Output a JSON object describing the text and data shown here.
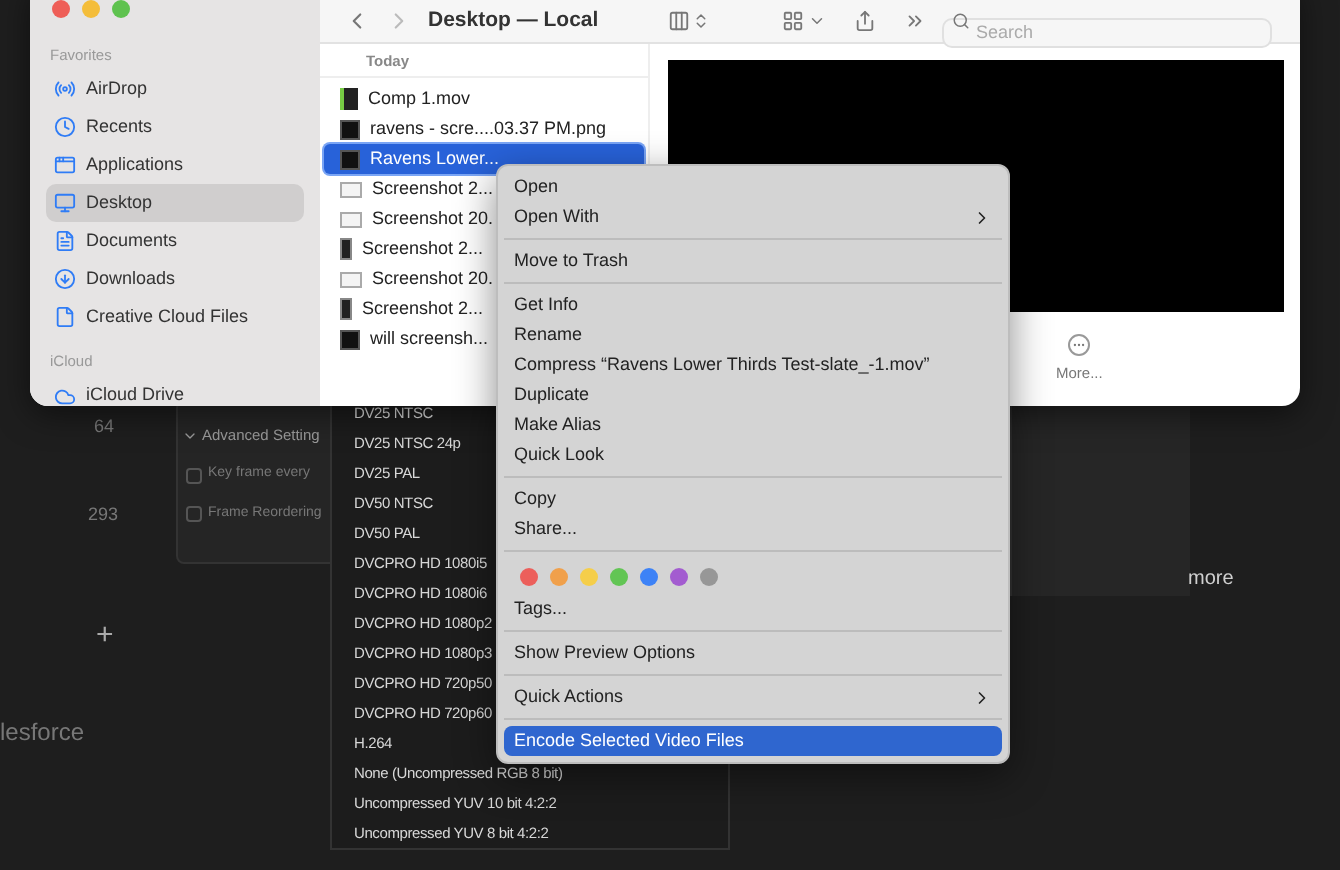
{
  "background_app": {
    "values": [
      "64",
      "293",
      "+",
      "lesforce"
    ],
    "advanced_settings": {
      "title": "Advanced Setting",
      "checkboxes": [
        {
          "label": "Key frame every",
          "checked": false
        },
        {
          "label": "Frame Reordering",
          "checked": false
        }
      ]
    },
    "link": "more"
  },
  "codec_list": {
    "items": [
      "DV25 NTSC",
      "DV25 NTSC 24p",
      "DV25 PAL",
      "DV50 NTSC",
      "DV50 PAL",
      "DVCPRO HD 1080i5",
      "DVCPRO HD 1080i6",
      "DVCPRO HD 1080p2",
      "DVCPRO HD 1080p3",
      "DVCPRO HD 720p50",
      "DVCPRO HD 720p60",
      "H.264",
      "None (Uncompressed RGB 8 bit)",
      "Uncompressed YUV 10 bit 4:2:2",
      "Uncompressed YUV 8 bit 4:2:2"
    ]
  },
  "finder": {
    "title": "Desktop — Local",
    "search": {
      "placeholder": "Search"
    },
    "sidebar": [
      {
        "heading": "Favorites",
        "items": [
          {
            "label": "AirDrop",
            "selected": false
          },
          {
            "label": "Recents",
            "selected": false
          },
          {
            "label": "Applications",
            "selected": false
          },
          {
            "label": "Desktop",
            "selected": true
          },
          {
            "label": "Documents",
            "selected": false
          },
          {
            "label": "Downloads",
            "selected": false
          },
          {
            "label": "Creative Cloud Files",
            "selected": false
          }
        ]
      },
      {
        "heading": "iCloud",
        "items": [
          {
            "label": "iCloud Drive",
            "selected": false
          }
        ]
      }
    ],
    "files": {
      "heading": "Today",
      "items": [
        {
          "name": "Comp 1.mov",
          "kind": "video",
          "selected": false
        },
        {
          "name": "ravens - scre....03.37 PM.png",
          "kind": "dark",
          "selected": false
        },
        {
          "name": "Ravens Lower...",
          "kind": "dark",
          "selected": true
        },
        {
          "name": "Screenshot 2...",
          "kind": "light",
          "selected": false
        },
        {
          "name": "Screenshot 20.",
          "kind": "light",
          "selected": false
        },
        {
          "name": "Screenshot 2...",
          "kind": "slim",
          "selected": false
        },
        {
          "name": "Screenshot 20.",
          "kind": "light",
          "selected": false
        },
        {
          "name": "Screenshot 2...",
          "kind": "slim",
          "selected": false
        },
        {
          "name": "will screensh...",
          "kind": "dark",
          "selected": false
        }
      ]
    },
    "preview": {
      "action": "More..."
    }
  },
  "context_menu": {
    "groups": [
      [
        {
          "kind": "text",
          "label": "Open",
          "submenu": false,
          "selected": false
        },
        {
          "kind": "text",
          "label": "Open With",
          "submenu": true,
          "selected": false
        }
      ],
      [
        {
          "kind": "text",
          "label": "Move to Trash",
          "submenu": false,
          "selected": false
        }
      ],
      [
        {
          "kind": "text",
          "label": "Get Info",
          "submenu": false,
          "selected": false
        },
        {
          "kind": "text",
          "label": "Rename",
          "submenu": false,
          "selected": false
        },
        {
          "kind": "text",
          "label": "Compress “Ravens Lower Thirds Test-slate_-1.mov”",
          "submenu": false,
          "selected": false
        },
        {
          "kind": "text",
          "label": "Duplicate",
          "submenu": false,
          "selected": false
        },
        {
          "kind": "text",
          "label": "Make Alias",
          "submenu": false,
          "selected": false
        },
        {
          "kind": "text",
          "label": "Quick Look",
          "submenu": false,
          "selected": false
        }
      ],
      [
        {
          "kind": "text",
          "label": "Copy",
          "submenu": false,
          "selected": false
        },
        {
          "kind": "text",
          "label": "Share...",
          "submenu": false,
          "selected": false
        }
      ],
      [
        {
          "kind": "colors",
          "tags": [
            {
              "color": "#ec5f5b"
            },
            {
              "color": "#f0a04b"
            },
            {
              "color": "#f5ce4a"
            },
            {
              "color": "#62c554"
            },
            {
              "color": "#3d82f6"
            },
            {
              "color": "#a35cd0"
            },
            {
              "color": "#979797"
            }
          ]
        },
        {
          "kind": "text",
          "label": "Tags...",
          "submenu": false,
          "selected": false
        }
      ],
      [
        {
          "kind": "text",
          "label": "Show Preview Options",
          "submenu": false,
          "selected": false
        }
      ],
      [
        {
          "kind": "text",
          "label": "Quick Actions",
          "submenu": true,
          "selected": false
        }
      ],
      [
        {
          "kind": "text",
          "label": "Encode Selected Video Files",
          "submenu": false,
          "selected": true
        }
      ]
    ]
  }
}
